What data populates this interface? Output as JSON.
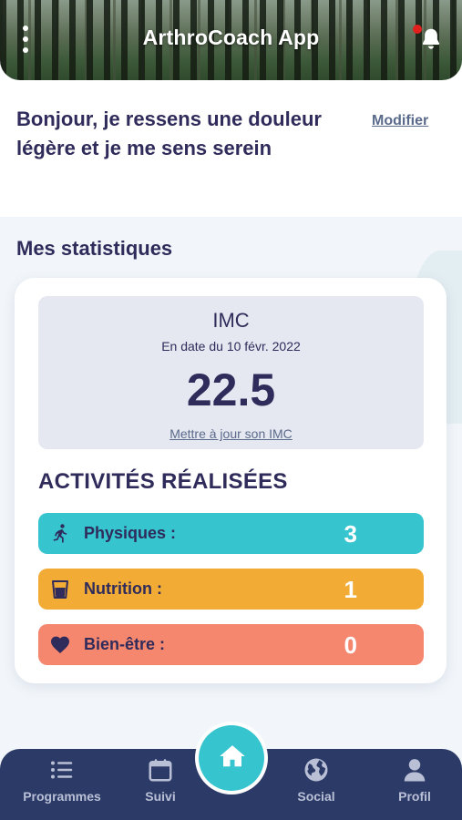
{
  "header": {
    "title": "ArthroCoach App",
    "menu_icon": "more-vertical-icon",
    "notification_icon": "bell-icon",
    "notification_dot_color": "#e0201c"
  },
  "greeting": {
    "text": "Bonjour, je ressens une douleur légère et je me sens serein",
    "edit_label": "Modifier"
  },
  "stats": {
    "title": "Mes statistiques",
    "imc": {
      "title": "IMC",
      "date": "En date du 10 févr. 2022",
      "value": "22.5",
      "update_link": "Mettre à jour son IMC"
    },
    "activities": {
      "title": "ACTIVITÉS RÉALISÉES",
      "items": [
        {
          "label": "Physiques :",
          "count": "3",
          "icon": "running-person-icon",
          "color": "#36c4cf"
        },
        {
          "label": "Nutrition :",
          "count": "1",
          "icon": "glass-icon",
          "color": "#f2ac36"
        },
        {
          "label": "Bien-être :",
          "count": "0",
          "icon": "heart-icon",
          "color": "#f6876f"
        }
      ]
    }
  },
  "bottom_nav": {
    "items": [
      {
        "label": "Programmes",
        "icon": "list-icon"
      },
      {
        "label": "Suivi",
        "icon": "calendar-icon"
      },
      {
        "label": "",
        "icon": "home-icon",
        "active": true
      },
      {
        "label": "Social",
        "icon": "globe-icon"
      },
      {
        "label": "Profil",
        "icon": "user-icon"
      }
    ],
    "accent_color": "#36c4cf",
    "background_color": "#2c3a67"
  }
}
